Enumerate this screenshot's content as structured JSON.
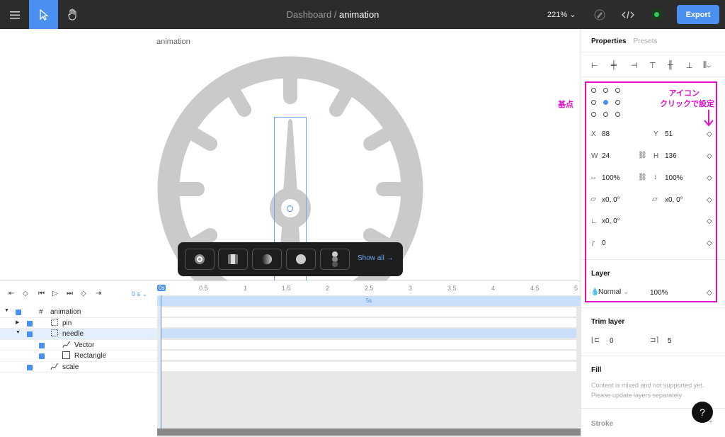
{
  "topbar": {
    "breadcrumb_parent": "Dashboard",
    "separator": " / ",
    "breadcrumb_current": "animation",
    "zoom": "221%",
    "export_label": "Export",
    "icons": [
      "menu-icon",
      "pointer-icon",
      "hand-icon",
      "pen-icon",
      "code-icon",
      "record-icon"
    ]
  },
  "canvas": {
    "frame_label": "animation"
  },
  "presets": {
    "show_all": "Show all →"
  },
  "timeline": {
    "time_display": "0 s",
    "ruler": [
      "0s",
      "0.5",
      "1",
      "1.5",
      "2",
      "2.5",
      "3",
      "3.5",
      "4",
      "4.5",
      "5"
    ],
    "duration_label": "5s",
    "layers": [
      {
        "name": "animation",
        "type": "frame",
        "expanded": true,
        "selected": false
      },
      {
        "name": "pin",
        "type": "group",
        "expanded": false,
        "selected": false
      },
      {
        "name": "needle",
        "type": "group",
        "expanded": true,
        "selected": true
      },
      {
        "name": "Vector",
        "type": "vector",
        "selected": false
      },
      {
        "name": "Rectangle",
        "type": "rect",
        "selected": false
      },
      {
        "name": "scale",
        "type": "vector",
        "selected": false
      }
    ]
  },
  "properties": {
    "tab_properties": "Properties",
    "tab_presets": "Presets",
    "x_label": "X",
    "x_value": "88",
    "y_label": "Y",
    "y_value": "51",
    "w_label": "W",
    "w_value": "24",
    "h_label": "H",
    "h_value": "136",
    "scale_x": "100%",
    "scale_y": "100%",
    "skew": "x0, 0°",
    "rotate": "x0, 0°",
    "shear": "x0, 0°",
    "radius": "0",
    "layer_title": "Layer",
    "blend_mode": "Normal",
    "opacity": "100%",
    "trim_title": "Trim layer",
    "trim_start": "0",
    "trim_end": "5",
    "fill_title": "Fill",
    "fill_note": "Content is mixed and not supported yet. Please update layers separately",
    "stroke_title": "Stroke",
    "help": "?"
  },
  "annotations": {
    "origin_label": "基点",
    "icon_line1": "アイコン",
    "icon_line2": "クリックで設定",
    "color": "#e010c8"
  }
}
